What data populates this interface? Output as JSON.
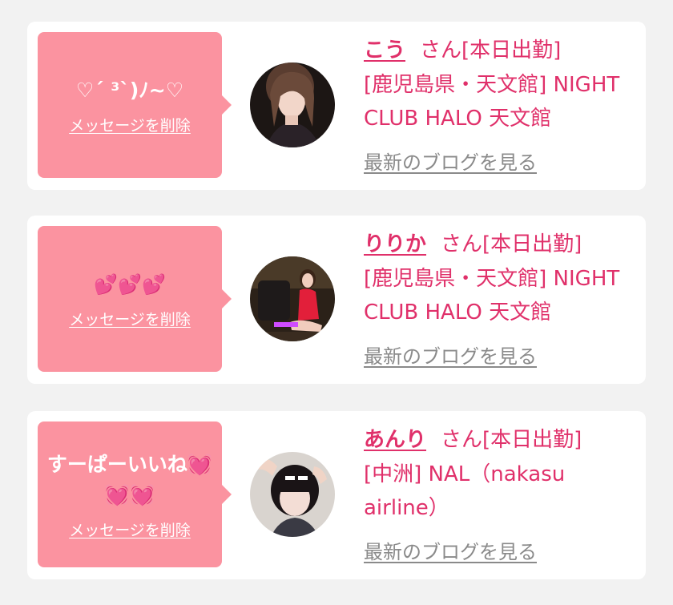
{
  "accent_color": "#e0306a",
  "bubble_color": "#fb93a0",
  "cards": [
    {
      "message": "♡´ ³`)ﾉ~♡",
      "delete_label": "メッセージを削除",
      "name": "こう",
      "honorific": "さん",
      "status": "[本日出勤]",
      "shop": "[鹿児島県・天文館] NIGHT CLUB HALO 天文館",
      "blog_label": "最新のブログを見る"
    },
    {
      "message": "💕💕💕",
      "delete_label": "メッセージを削除",
      "name": "りりか",
      "honorific": "さん",
      "status": "[本日出勤]",
      "shop": "[鹿児島県・天文館] NIGHT CLUB HALO 天文館",
      "blog_label": "最新のブログを見る"
    },
    {
      "message": "すーぱーいいね💓💓💓",
      "delete_label": "メッセージを削除",
      "name": "あんり",
      "honorific": "さん",
      "status": "[本日出勤]",
      "shop": "[中洲]  NAL（nakasu airline）",
      "blog_label": "最新のブログを見る"
    }
  ]
}
